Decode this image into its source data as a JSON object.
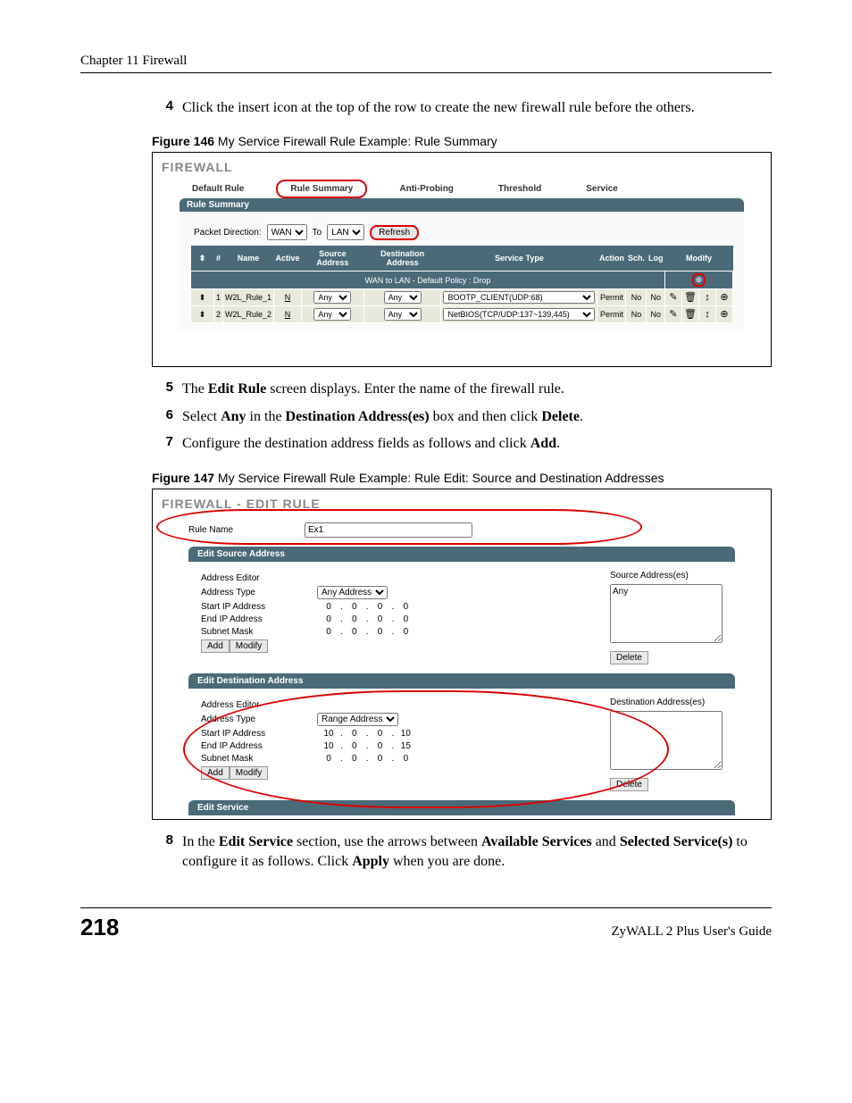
{
  "chapter_header": "Chapter 11 Firewall",
  "steps": {
    "s4n": "4",
    "s4t_a": "Click the insert icon at the top of the row to create the new firewall rule before the others.",
    "s5n": "5",
    "s5t_a": "The ",
    "s5t_b": "Edit Rule",
    "s5t_c": " screen displays. Enter the name of the firewall rule.",
    "s6n": "6",
    "s6t_a": "Select ",
    "s6t_b": "Any",
    "s6t_c": " in the ",
    "s6t_d": "Destination Address(es)",
    "s6t_e": " box and then click ",
    "s6t_f": "Delete",
    "s6t_g": ".",
    "s7n": "7",
    "s7t": "Configure the destination address fields as follows and click ",
    "s7t_b": "Add",
    "s7t_c": ".",
    "s8n": "8",
    "s8t_a": "In the ",
    "s8t_b": "Edit Service",
    "s8t_c": " section, use the arrows between ",
    "s8t_d": "Available Services",
    "s8t_e": " and ",
    "s8t_f": "Selected Service(s)",
    "s8t_g": " to configure it as follows. Click ",
    "s8t_h": "Apply",
    "s8t_i": " when you are done."
  },
  "fig146": {
    "label_b": "Figure 146",
    "label_t": "   My Service Firewall Rule Example: Rule Summary",
    "title": "FIREWALL",
    "tabs": {
      "t1": "Default Rule",
      "t2": "Rule Summary",
      "t3": "Anti-Probing",
      "t4": "Threshold",
      "t5": "Service"
    },
    "section_title": "Rule Summary",
    "pd_label": "Packet Direction:",
    "pd_from": "WAN",
    "pd_to_label": "To",
    "pd_to": "LAN",
    "refresh": "Refresh",
    "hdr": {
      "idx": "#",
      "name": "Name",
      "active": "Active",
      "src": "Source Address",
      "dst": "Destination Address",
      "svc": "Service Type",
      "action": "Action",
      "sch": "Sch.",
      "log": "Log",
      "modify": "Modify"
    },
    "default_row": "WAN to LAN - Default Policy : Drop",
    "row1": {
      "idx": "1",
      "name": "W2L_Rule_1",
      "active": "N",
      "src": "Any",
      "dst": "Any",
      "svc": "BOOTP_CLIENT(UDP:68)",
      "action": "Permit",
      "sch": "No",
      "log": "No"
    },
    "row2": {
      "idx": "2",
      "name": "W2L_Rule_2",
      "active": "N",
      "src": "Any",
      "dst": "Any",
      "svc": "NetBIOS(TCP/UDP:137~139,445)",
      "action": "Permit",
      "sch": "No",
      "log": "No"
    }
  },
  "fig147": {
    "label_b": "Figure 147",
    "label_t": "   My Service Firewall Rule Example: Rule Edit: Source and Destination Addresses",
    "title": "FIREWALL - EDIT RULE",
    "rule_name_label": "Rule Name",
    "rule_name_value": "Ex1",
    "src_header": "Edit Source Address",
    "editor_label": "Address Editor",
    "addr_type_label": "Address Type",
    "start_ip_label": "Start IP Address",
    "end_ip_label": "End IP Address",
    "subnet_label": "Subnet Mask",
    "add_btn": "Add",
    "modify_btn": "Modify",
    "delete_btn": "Delete",
    "src_addr_type": "Any Address",
    "src_start": [
      "0",
      "0",
      "0",
      "0"
    ],
    "src_end": [
      "0",
      "0",
      "0",
      "0"
    ],
    "src_mask": [
      "0",
      "0",
      "0",
      "0"
    ],
    "src_list_label": "Source Address(es)",
    "src_list_value": "Any",
    "dst_header": "Edit Destination Address",
    "dst_addr_type": "Range Address",
    "dst_start": [
      "10",
      "0",
      "0",
      "10"
    ],
    "dst_end": [
      "10",
      "0",
      "0",
      "15"
    ],
    "dst_mask": [
      "0",
      "0",
      "0",
      "0"
    ],
    "dst_list_label": "Destination Address(es)",
    "svc_header": "Edit Service"
  },
  "footer": {
    "page": "218",
    "guide": "ZyWALL 2 Plus User's Guide"
  }
}
